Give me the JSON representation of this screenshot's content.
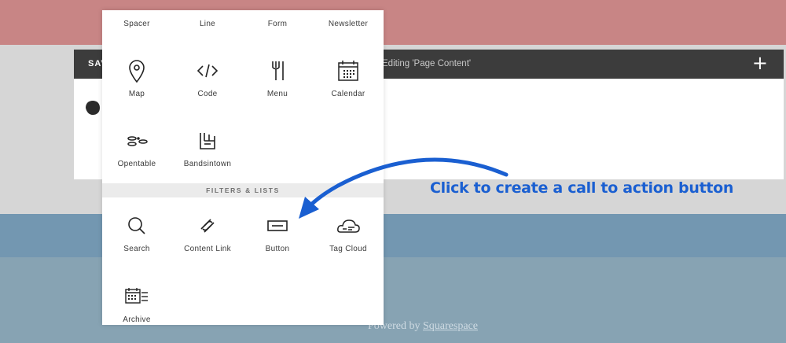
{
  "editor": {
    "save_label": "SAV",
    "title": "Editing 'Page Content'",
    "add_label": "+"
  },
  "footer": {
    "prefix": "Powered by",
    "brand": "Squarespace"
  },
  "block_panel": {
    "top_row": [
      "Spacer",
      "Line",
      "Form",
      "Newsletter"
    ],
    "blocks_row1": [
      {
        "label": "Map",
        "icon": "map-pin-icon"
      },
      {
        "label": "Code",
        "icon": "code-icon"
      },
      {
        "label": "Menu",
        "icon": "fork-knife-icon"
      },
      {
        "label": "Calendar",
        "icon": "calendar-icon"
      }
    ],
    "blocks_row2": [
      {
        "label": "Opentable",
        "icon": "opentable-icon"
      },
      {
        "label": "Bandsintown",
        "icon": "bandsintown-icon"
      }
    ],
    "section_title": "FILTERS & LISTS",
    "blocks_row3": [
      {
        "label": "Search",
        "icon": "search-icon"
      },
      {
        "label": "Content Link",
        "icon": "content-link-icon"
      },
      {
        "label": "Button",
        "icon": "button-icon"
      },
      {
        "label": "Tag Cloud",
        "icon": "tag-cloud-icon"
      }
    ],
    "blocks_row4": [
      {
        "label": "Archive",
        "icon": "archive-icon"
      }
    ]
  },
  "annotation": {
    "text": "Click to create a call to action button",
    "color": "#1a5fd1"
  },
  "colors": {
    "header_band": "#c88585",
    "blue_band": "#7397b1",
    "editor_bar": "#3c3c3c"
  }
}
